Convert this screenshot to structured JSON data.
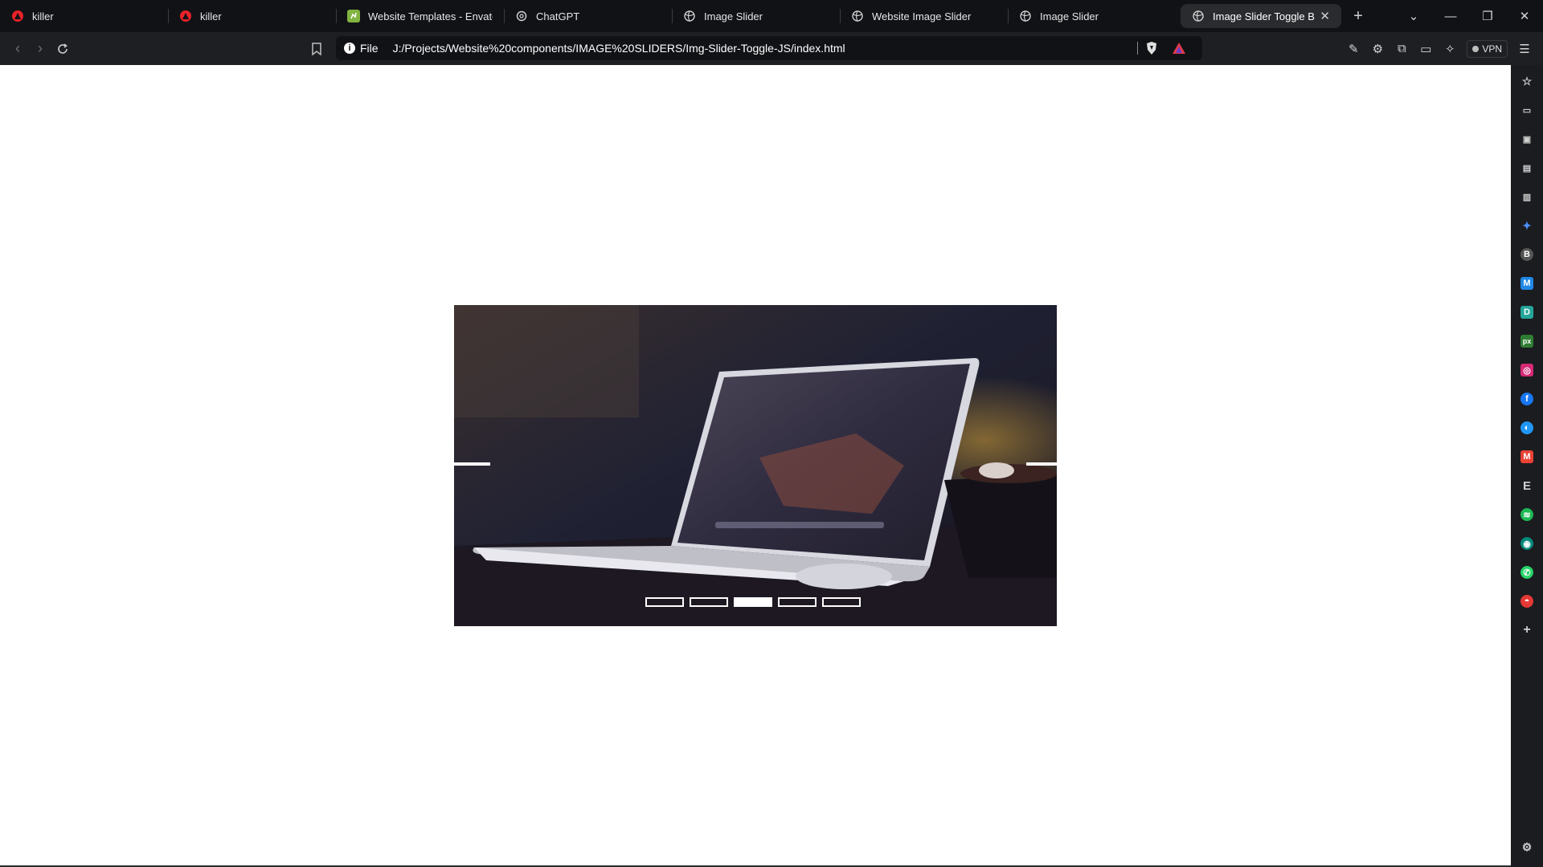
{
  "tabs": [
    {
      "title": "killer",
      "icon": "opera-icon",
      "active": false
    },
    {
      "title": "killer",
      "icon": "opera-icon",
      "active": false
    },
    {
      "title": "Website Templates - Envato",
      "icon": "envato-icon",
      "active": false
    },
    {
      "title": "ChatGPT",
      "icon": "chatgpt-icon",
      "active": false
    },
    {
      "title": "Image Slider",
      "icon": "globe-icon",
      "active": false
    },
    {
      "title": "Website Image Slider",
      "icon": "globe-icon",
      "active": false
    },
    {
      "title": "Image Slider",
      "icon": "globe-icon",
      "active": false
    },
    {
      "title": "Image Slider Toggle Butto",
      "icon": "globe-icon",
      "active": true
    }
  ],
  "address_bar": {
    "scheme_label": "File",
    "url": "J:/Projects/Website%20components/IMAGE%20SLIDERS/Img-Slider-Toggle-JS/index.html"
  },
  "toolbar": {
    "vpn_label": "VPN"
  },
  "slider": {
    "slide_count": 5,
    "active_index": 2,
    "image_description": "laptop on desk in dark room"
  },
  "colors": {
    "tab_strip": "#111216",
    "toolbar": "#1e1f23",
    "page_background": "#ffffff",
    "side_panel": "#1b1c20"
  },
  "side_panel_icons": [
    "bookmark-star-icon",
    "video-icon",
    "wallet-icon",
    "reading-list-icon",
    "book-icon",
    "leo-ai-icon",
    "brave-icon",
    "malwarebytes-icon",
    "dribbble-icon",
    "pixabay-icon",
    "instagram-icon",
    "facebook-icon",
    "messenger-icon",
    "gmail-icon",
    "envato-icon",
    "spotify-icon",
    "copilot-icon",
    "whatsapp-icon",
    "github-icon",
    "add-icon",
    "settings-icon"
  ]
}
